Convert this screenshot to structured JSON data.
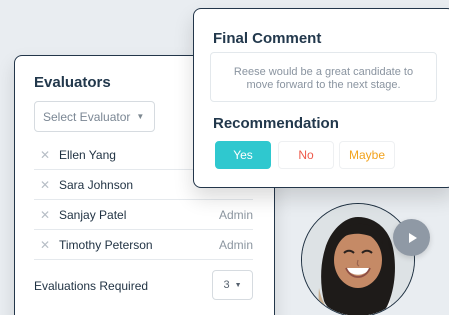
{
  "evaluators": {
    "title": "Evaluators",
    "select_placeholder": "Select Evaluator",
    "items": [
      {
        "name": "Ellen Yang",
        "role": ""
      },
      {
        "name": "Sara Johnson",
        "role": ""
      },
      {
        "name": "Sanjay Patel",
        "role": "Admin"
      },
      {
        "name": "Timothy Peterson",
        "role": "Admin"
      }
    ],
    "required_label": "Evaluations Required",
    "required_value": "3"
  },
  "comment": {
    "title": "Final Comment",
    "text": "Reese would be a great candidate to move forward to the next stage."
  },
  "recommendation": {
    "title": "Recommendation",
    "options": {
      "yes": "Yes",
      "no": "No",
      "maybe": "Maybe"
    },
    "selected": "Yes"
  },
  "icons": {
    "remove": "close-icon",
    "caret": "chevron-down-icon",
    "play": "play-icon"
  },
  "colors": {
    "accent_teal": "#2fc8cf",
    "no_red": "#ee5a4b",
    "maybe_orange": "#f2a31d",
    "text_dark": "#22384c"
  }
}
